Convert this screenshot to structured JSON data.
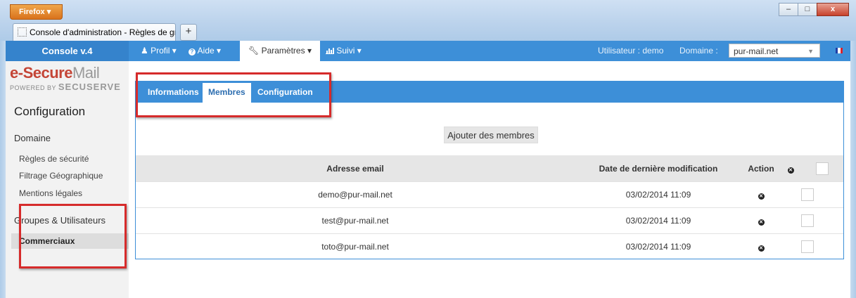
{
  "browser": {
    "menu_button": "Firefox",
    "tab_title": "Console d'administration - Règles de gr...",
    "new_tab": "+",
    "win_min": "–",
    "win_max": "□",
    "win_close": "x"
  },
  "navbar": {
    "brand": "Console v.4",
    "items": [
      {
        "label": "Profil",
        "icon": "user-icon"
      },
      {
        "label": "Aide",
        "icon": "question-icon"
      },
      {
        "label": "Paramètres",
        "icon": "wrench-icon"
      },
      {
        "label": "Suivi",
        "icon": "bar-chart-icon"
      }
    ],
    "user_label": "Utilisateur : demo",
    "domain_label": "Domaine :",
    "domain_value": "pur-mail.net",
    "flag_colors": [
      "#1f3fa6",
      "#ffffff",
      "#d9232c"
    ]
  },
  "logo": {
    "e": "e-",
    "secure": "Secure",
    "mail": "Mail",
    "powered": "POWERED BY",
    "secuserve": "SECUSERVE"
  },
  "sidebar": {
    "title": "Configuration",
    "section1": "Domaine",
    "links": [
      "Règles de sécurité",
      "Filtrage Géographique",
      "Mentions légales"
    ],
    "section2": "Groupes & Utilisateurs",
    "active": "Commerciaux"
  },
  "panel": {
    "tabs": [
      "Informations",
      "Membres",
      "Configuration"
    ],
    "active_tab": "Membres",
    "add_button": "Ajouter des membres",
    "headers": {
      "email": "Adresse email",
      "date": "Date de dernière modification",
      "action": "Action"
    },
    "rows": [
      {
        "email": "demo@pur-mail.net",
        "date": "03/02/2014 11:09"
      },
      {
        "email": "test@pur-mail.net",
        "date": "03/02/2014 11:09"
      },
      {
        "email": "toto@pur-mail.net",
        "date": "03/02/2014 11:09"
      }
    ]
  },
  "colors": {
    "accent": "#3d8fd8",
    "highlight": "#d62b2b"
  }
}
